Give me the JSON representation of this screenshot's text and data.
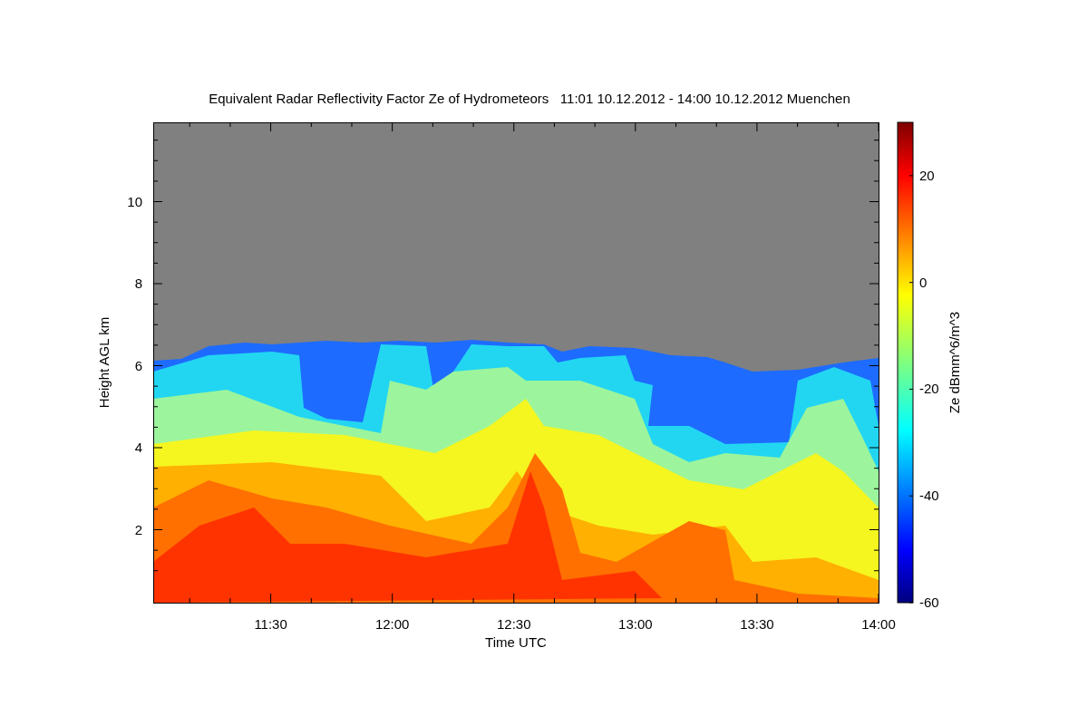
{
  "title": "Equivalent Radar Reflectivity Factor Ze of Hydrometeors   11:01 10.12.2012 - 14:00 10.12.2012 Muenchen",
  "x_axis": {
    "label": "Time UTC",
    "ticks": [
      "11:30",
      "12:00",
      "12:30",
      "13:00",
      "13:30",
      "14:00"
    ]
  },
  "y_axis": {
    "label": "Height AGL km",
    "ticks": [
      "10",
      "8",
      "6",
      "4",
      "2"
    ]
  },
  "colorbar": {
    "label": "Ze dBmm^6/m^3",
    "ticks": [
      "20",
      "0",
      "-20",
      "-40",
      "-60"
    ]
  }
}
